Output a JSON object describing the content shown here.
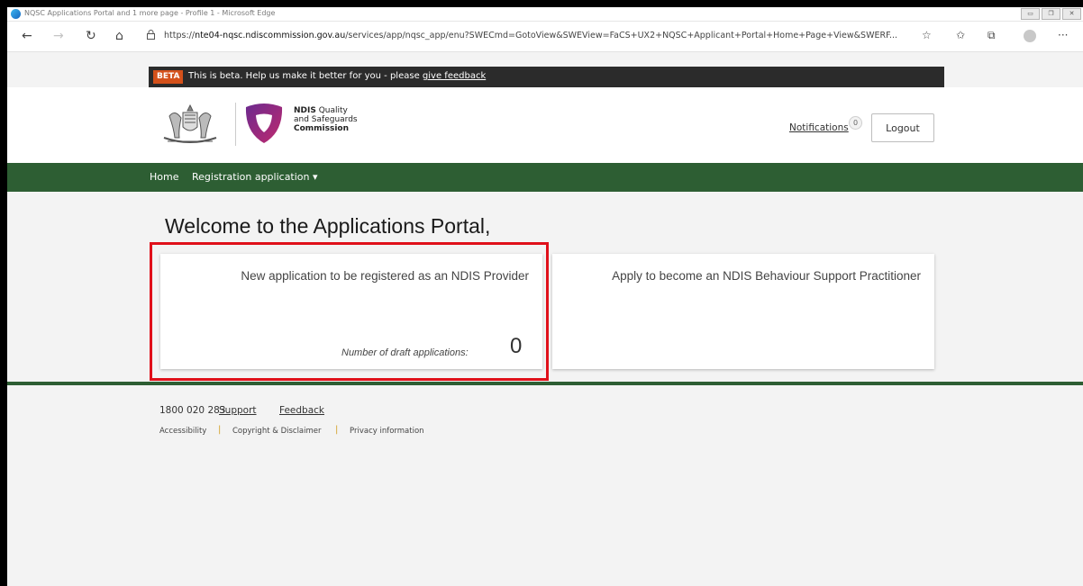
{
  "browser": {
    "window_title": "NQSC Applications Portal and 1 more page - Profile 1 - Microsoft Edge",
    "url_prefix": "https://",
    "url_host": "nte04-nqsc.ndiscommission.gov.au",
    "url_path": "/services/app/nqsc_app/enu?SWECmd=GotoView&SWEView=FaCS+UX2+NQSC+Applicant+Portal+Home+Page+View&SWERF...",
    "back_glyph": "←",
    "forward_glyph": "→",
    "refresh_glyph": "↻",
    "home_glyph": "⌂",
    "menu_glyph": "···"
  },
  "beta": {
    "tag": "BETA",
    "text": "This is beta. Help us make it better for you - please",
    "link": "give feedback"
  },
  "header": {
    "org_line1_bold": "NDIS",
    "org_line1_rest": " Quality",
    "org_line2": "and Safeguards",
    "org_line3": "Commission",
    "notifications_label": "Notifications",
    "notifications_count": "0",
    "logout_label": "Logout"
  },
  "nav": {
    "home": "Home",
    "registration": "Registration application",
    "registration_caret": "▾"
  },
  "main": {
    "welcome": "Welcome to the Applications Portal,",
    "cards": [
      {
        "title": "New application to be registered as an NDIS Provider",
        "draft_label": "Number of draft applications:",
        "draft_count": "0"
      },
      {
        "title": "Apply to become an NDIS Behaviour Support Practitioner"
      }
    ]
  },
  "footer": {
    "phone": "1800 020 283",
    "support": "Support",
    "feedback": "Feedback",
    "accessibility": "Accessibility",
    "copyright": "Copyright & Disclaimer",
    "privacy": "Privacy information",
    "separator": "|"
  },
  "colors": {
    "nav_green": "#2d5e33",
    "beta_orange": "#d4511b",
    "highlight_red": "#e0101a"
  }
}
